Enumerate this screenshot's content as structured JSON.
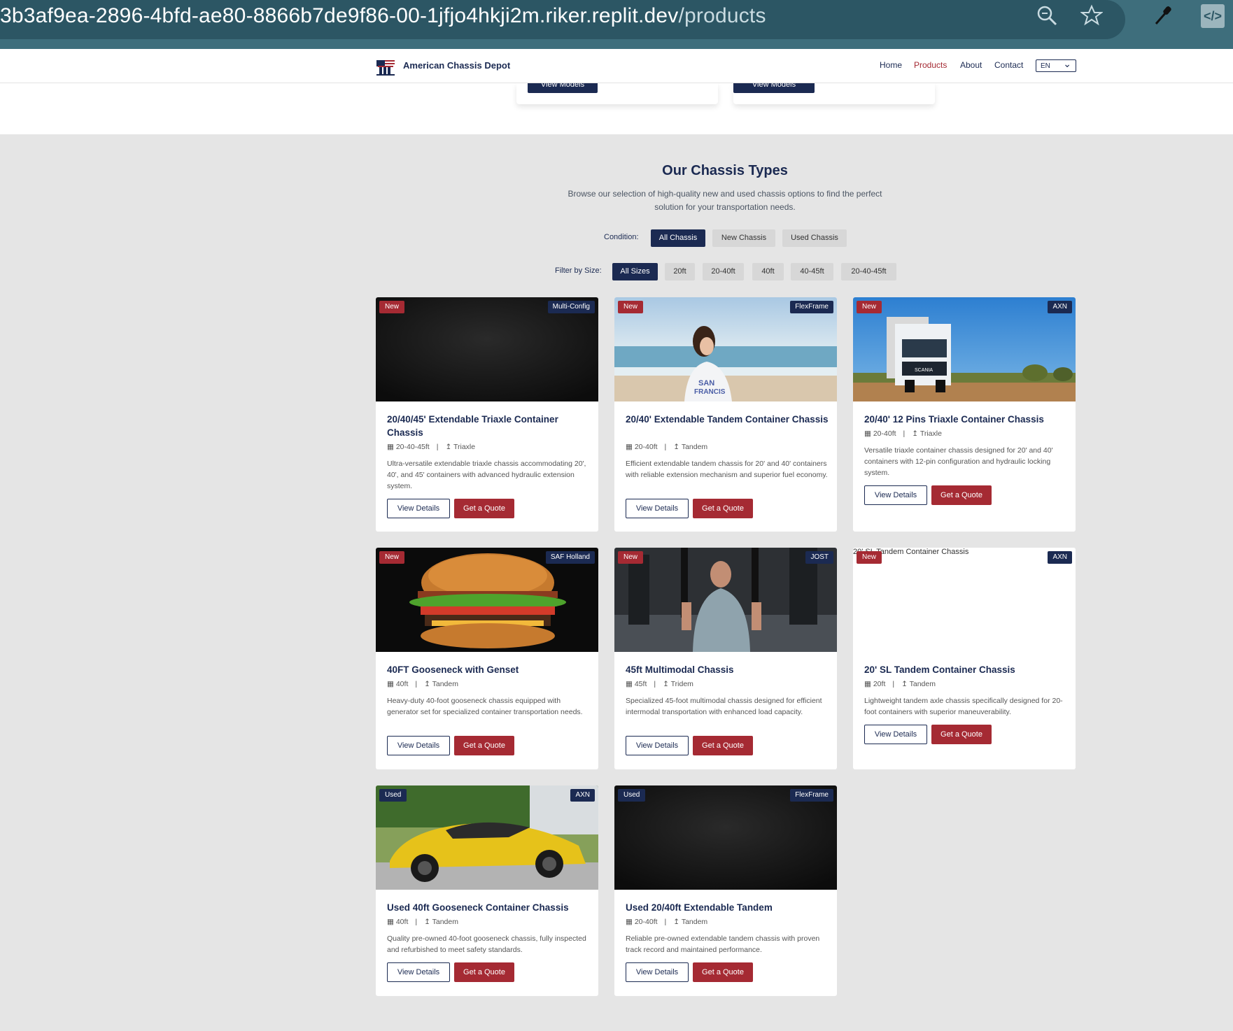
{
  "browser": {
    "url_host": "3b3af9ea-2896-4bfd-ae80-8866b7de9f86-00-1jfjo4hkji2m.riker.replit.dev",
    "url_path": "/products",
    "icons": [
      "zoom-icon",
      "star-icon",
      "eyedropper-icon",
      "devtools-icon"
    ]
  },
  "header": {
    "brand": "American Chassis Depot",
    "nav": [
      "Home",
      "Products",
      "About",
      "Contact"
    ],
    "active_nav": "Products",
    "language": "EN"
  },
  "top_cards": {
    "button_label": "View Models"
  },
  "section": {
    "title": "Our Chassis Types",
    "subtitle": "Browse our selection of high-quality new and used chassis options to find the perfect solution for your transportation needs."
  },
  "filters": {
    "condition_label": "Condition:",
    "condition_options": [
      "All Chassis",
      "New Chassis",
      "Used Chassis"
    ],
    "condition_selected": "All Chassis",
    "size_label": "Filter by Size:",
    "size_options": [
      "All Sizes",
      "20ft",
      "20-40ft",
      "40ft",
      "40-45ft",
      "20-40-45ft"
    ],
    "size_selected": "All Sizes"
  },
  "buttons": {
    "details": "View Details",
    "quote": "Get a Quote"
  },
  "products": [
    {
      "condition": "New",
      "brand": "Multi-Config",
      "title": "20/40/45' Extendable Triaxle Container Chassis",
      "size": "20-40-45ft",
      "axle": "Triaxle",
      "description": "Ultra-versatile extendable triaxle chassis accommodating 20', 40', and 45' containers with advanced hydraulic extension system.",
      "image": "dark-texture"
    },
    {
      "condition": "New",
      "brand": "FlexFrame",
      "title": "20/40' Extendable Tandem Container Chassis",
      "size": "20-40ft",
      "axle": "Tandem",
      "description": "Efficient extendable tandem chassis for 20' and 40' containers with reliable extension mechanism and superior fuel economy.",
      "image": "beach-woman"
    },
    {
      "condition": "New",
      "brand": "AXN",
      "title": "20/40' 12 Pins Triaxle Container Chassis",
      "size": "20-40ft",
      "axle": "Triaxle",
      "description": "Versatile triaxle container chassis designed for 20' and 40' containers with 12-pin configuration and hydraulic locking system.",
      "image": "truck"
    },
    {
      "condition": "New",
      "brand": "SAF Holland",
      "title": "40FT Gooseneck with Genset",
      "size": "40ft",
      "axle": "Tandem",
      "description": "Heavy-duty 40-foot gooseneck chassis equipped with generator set for specialized container transportation needs.",
      "image": "burger"
    },
    {
      "condition": "New",
      "brand": "JOST",
      "title": "45ft Multimodal Chassis",
      "size": "45ft",
      "axle": "Tridem",
      "description": "Specialized 45-foot multimodal chassis designed for efficient intermodal transportation with enhanced load capacity.",
      "image": "gym"
    },
    {
      "condition": "New",
      "brand": "AXN",
      "title": "20' SL Tandem Container Chassis",
      "size": "20ft",
      "axle": "Tandem",
      "description": "Lightweight tandem axle chassis specifically designed for 20-foot containers with superior maneuverability.",
      "image": "broken",
      "alt": "20' SL Tandem Container Chassis"
    },
    {
      "condition": "Used",
      "brand": "AXN",
      "title": "Used 40ft Gooseneck Container Chassis",
      "size": "40ft",
      "axle": "Tandem",
      "description": "Quality pre-owned 40-foot gooseneck chassis, fully inspected and refurbished to meet safety standards.",
      "image": "yellow-car"
    },
    {
      "condition": "Used",
      "brand": "FlexFrame",
      "title": "Used 20/40ft Extendable Tandem",
      "size": "20-40ft",
      "axle": "Tandem",
      "description": "Reliable pre-owned extendable tandem chassis with proven track record and maintained performance.",
      "image": "dark-texture"
    }
  ]
}
